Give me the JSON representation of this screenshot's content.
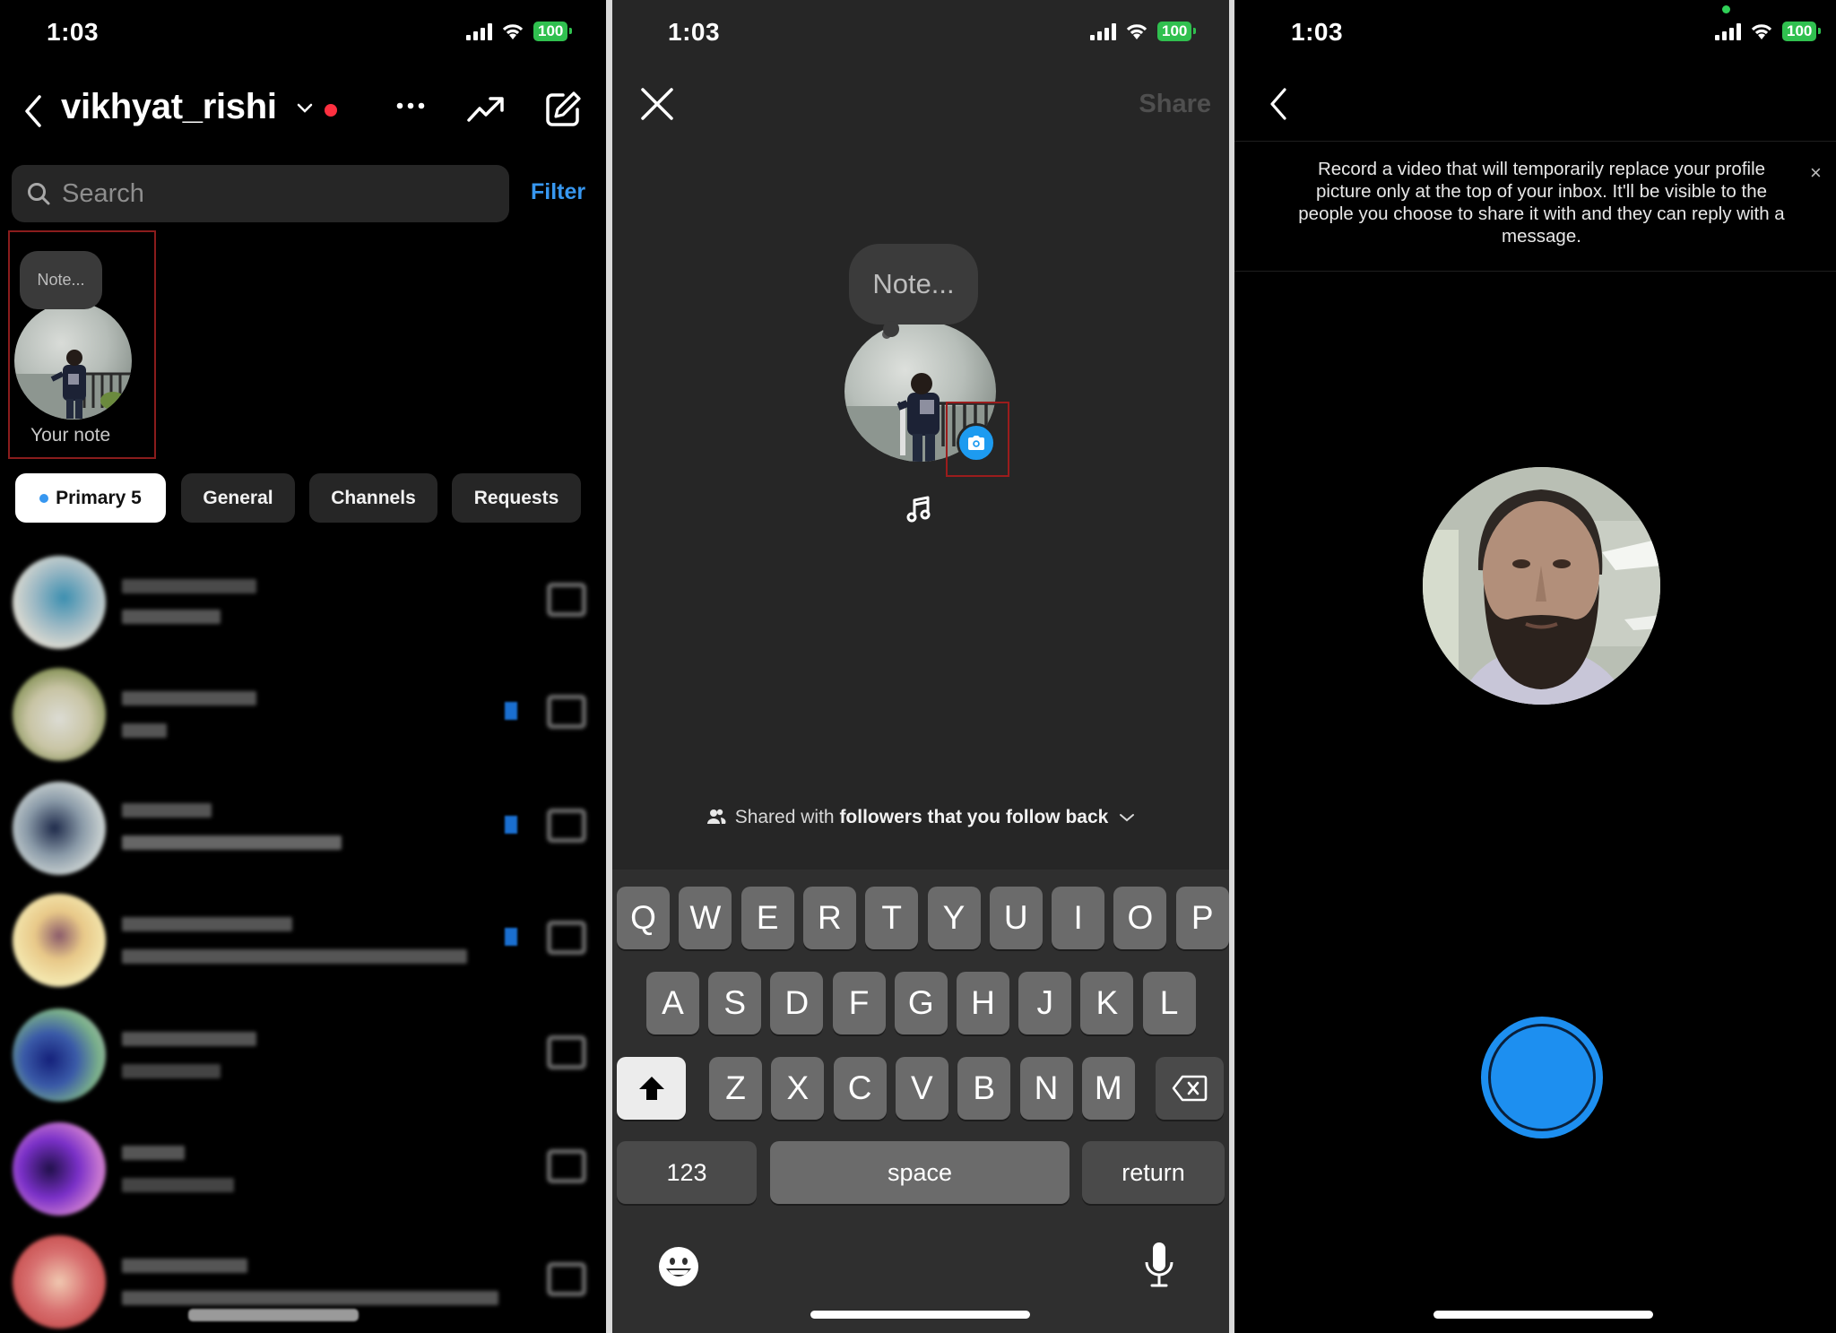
{
  "status_bar": {
    "time": "1:03",
    "battery": "100"
  },
  "panel_inbox": {
    "username": "vikhyat_rishi",
    "icons": [
      "back-chevron-icon",
      "chevron-down-icon",
      "more-icon",
      "trending-icon",
      "compose-icon"
    ],
    "search": {
      "placeholder": "Search"
    },
    "filter_label": "Filter",
    "note": {
      "bubble_text": "Note...",
      "caption": "Your note"
    },
    "tabs": [
      {
        "label": "Primary 5",
        "active": true
      },
      {
        "label": "General",
        "active": false
      },
      {
        "label": "Channels",
        "active": false
      },
      {
        "label": "Requests",
        "active": false
      }
    ],
    "chats_note": "Conversation list is pixelated/obscured",
    "chat_count": 7
  },
  "panel_note_editor": {
    "close_icon": "close-icon",
    "share_label": "Share",
    "note_placeholder": "Note...",
    "camera_icon": "camera-icon",
    "music_icon": "music-note-icon",
    "audience": {
      "prefix": "Shared with",
      "value": "followers that you follow back"
    },
    "keyboard": {
      "row1": [
        "Q",
        "W",
        "E",
        "R",
        "T",
        "Y",
        "U",
        "I",
        "O",
        "P"
      ],
      "row2": [
        "A",
        "S",
        "D",
        "F",
        "G",
        "H",
        "J",
        "K",
        "L"
      ],
      "row3": [
        "Z",
        "X",
        "C",
        "V",
        "B",
        "N",
        "M"
      ],
      "numbers_label": "123",
      "space_label": "space",
      "return_label": "return"
    }
  },
  "panel_video_note": {
    "info_text": "Record a video that will temporarily replace your profile picture only at the top of your inbox. It'll be visible to the people you choose to share it with and they can reply with a message.",
    "close_label": "×",
    "record_button_color": "#1d8ff0"
  },
  "colors": {
    "accent_blue": "#3797f0",
    "battery_green": "#30c04f",
    "notification_red": "#ff3040",
    "highlight_box": "#9b1c1c"
  }
}
